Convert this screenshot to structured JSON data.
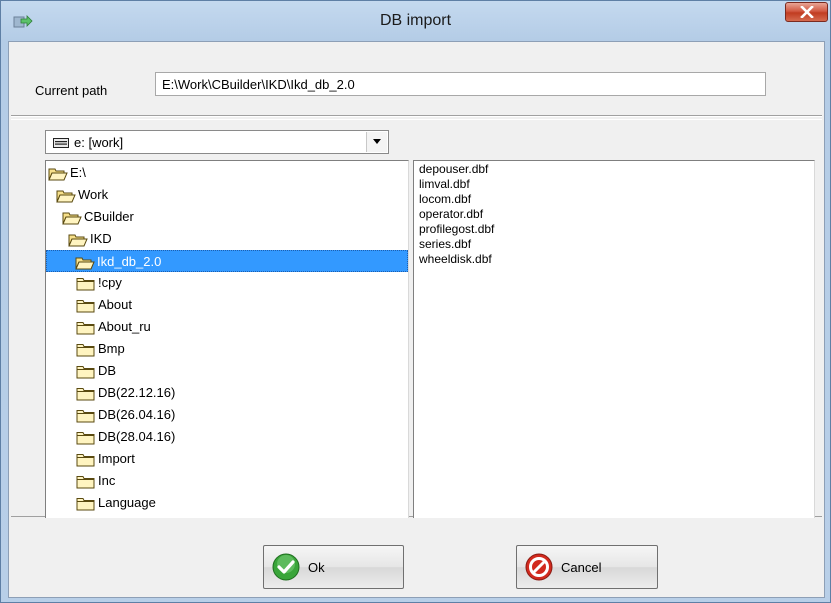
{
  "window": {
    "title": "DB import"
  },
  "path": {
    "label": "Current path",
    "value": "E:\\Work\\CBuilder\\IKD\\Ikd_db_2.0"
  },
  "drive": {
    "selected": "e: [work]"
  },
  "directories": [
    {
      "label": "E:\\",
      "open": true,
      "selected": false
    },
    {
      "label": "Work",
      "open": true,
      "selected": false
    },
    {
      "label": "CBuilder",
      "open": true,
      "selected": false
    },
    {
      "label": "IKD",
      "open": true,
      "selected": false
    },
    {
      "label": "Ikd_db_2.0",
      "open": true,
      "selected": true
    },
    {
      "label": "!cpy",
      "open": false,
      "selected": false
    },
    {
      "label": "About",
      "open": false,
      "selected": false
    },
    {
      "label": "About_ru",
      "open": false,
      "selected": false
    },
    {
      "label": "Bmp",
      "open": false,
      "selected": false
    },
    {
      "label": "DB",
      "open": false,
      "selected": false
    },
    {
      "label": "DB(22.12.16)",
      "open": false,
      "selected": false
    },
    {
      "label": "DB(26.04.16)",
      "open": false,
      "selected": false
    },
    {
      "label": "DB(28.04.16)",
      "open": false,
      "selected": false
    },
    {
      "label": "Import",
      "open": false,
      "selected": false
    },
    {
      "label": "Inc",
      "open": false,
      "selected": false
    },
    {
      "label": "Language",
      "open": false,
      "selected": false
    }
  ],
  "files": [
    "depouser.dbf",
    "limval.dbf",
    "locom.dbf",
    "operator.dbf",
    "profilegost.dbf",
    "series.dbf",
    "wheeldisk.dbf"
  ],
  "buttons": {
    "ok": "Ok",
    "cancel": "Cancel"
  },
  "icons": {
    "title": "import-arrow-icon",
    "close": "close-icon",
    "drive": "drive-icon",
    "folder_open": "folder-open-icon",
    "folder_closed": "folder-closed-icon",
    "ok": "check-icon",
    "cancel": "cancel-icon"
  },
  "colors": {
    "selection": "#3399ff",
    "close": "#c13c21",
    "ok_icon": "#3aa53a",
    "cancel_icon": "#d22a1e"
  }
}
